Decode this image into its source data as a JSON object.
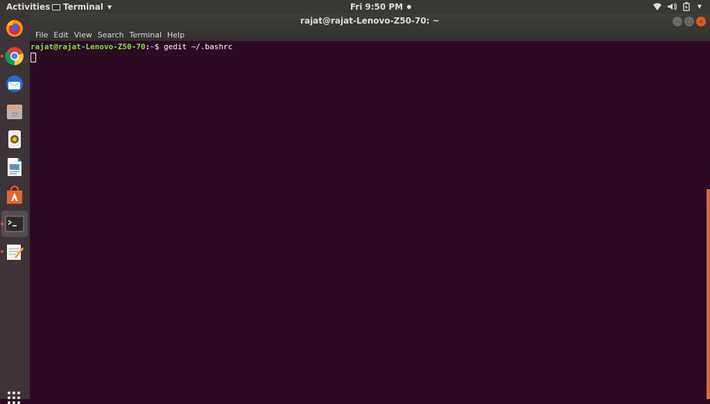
{
  "topbar": {
    "activities": "Activities",
    "app_menu": "Terminal",
    "day": "Fri",
    "time": "9:50 PM",
    "tray_icons": [
      "wifi-icon",
      "volume-icon",
      "battery-icon",
      "system-menu-icon"
    ]
  },
  "dock": {
    "items": [
      {
        "name": "firefox",
        "icon": "firefox-icon",
        "running": false
      },
      {
        "name": "chrome",
        "icon": "chrome-icon",
        "running": true
      },
      {
        "name": "thunderbird",
        "icon": "thunderbird-icon",
        "running": false
      },
      {
        "name": "files",
        "icon": "files-icon",
        "running": false
      },
      {
        "name": "rhythmbox",
        "icon": "rhythmbox-icon",
        "running": false
      },
      {
        "name": "libreoffice-writer",
        "icon": "writer-icon",
        "running": false
      },
      {
        "name": "ubuntu-software",
        "icon": "software-icon",
        "running": false
      },
      {
        "name": "terminal",
        "icon": "terminal-icon",
        "running": true,
        "active": true
      },
      {
        "name": "text-editor",
        "icon": "text-editor-icon",
        "running": true
      }
    ],
    "show_apps": "show-applications-icon"
  },
  "window": {
    "title": "rajat@rajat-Lenovo-Z50-70: ~",
    "menu": [
      "File",
      "Edit",
      "View",
      "Search",
      "Terminal",
      "Help"
    ],
    "terminal": {
      "prompt_user": "rajat@rajat-Lenovo-Z50-70",
      "prompt_sep": ":",
      "prompt_path": "~",
      "prompt_symbol": "$ ",
      "command": "gedit ~/.bashrc"
    }
  },
  "colors": {
    "terminal_bg": "#2c0a24",
    "prompt_user": "#8ae234",
    "prompt_path": "#729fcf",
    "accent": "#e95420"
  }
}
